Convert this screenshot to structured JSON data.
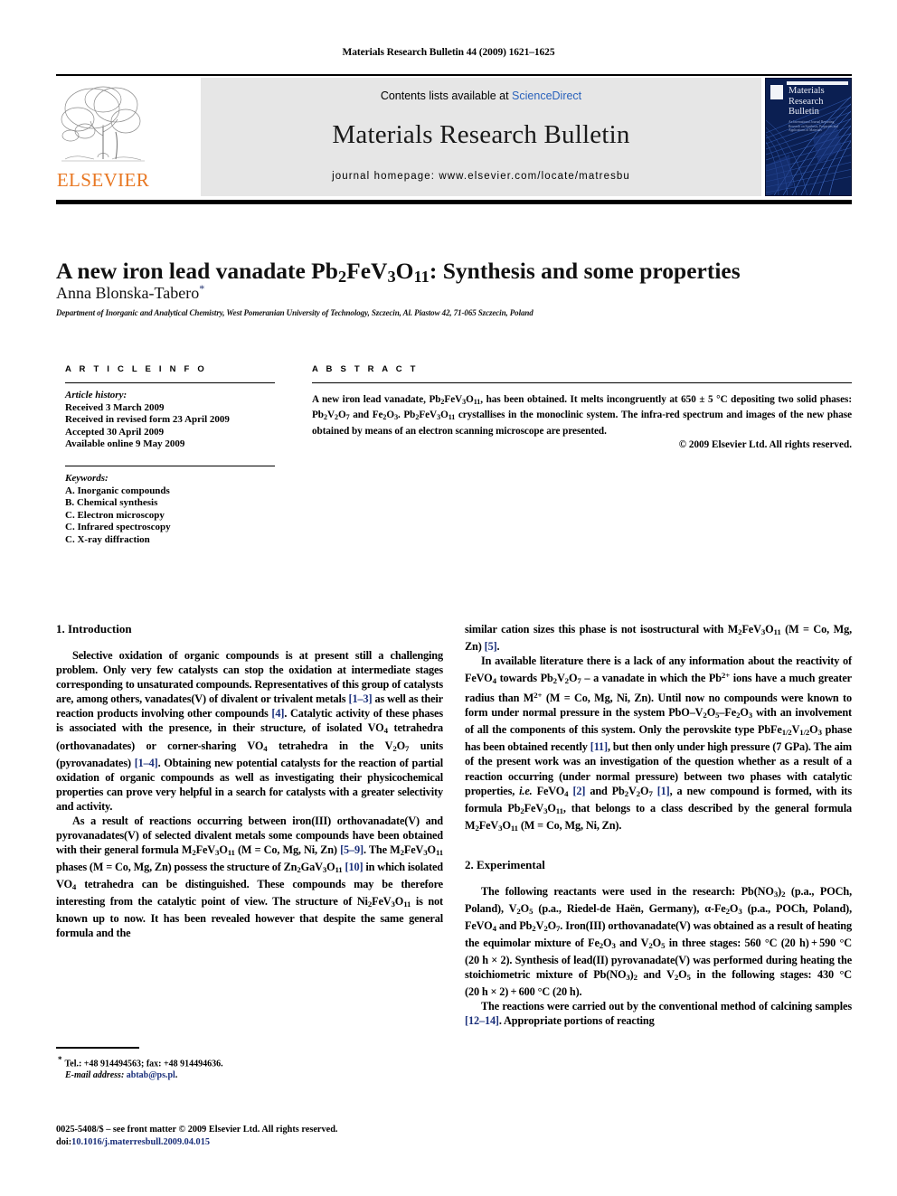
{
  "running_head": "Materials Research Bulletin 44 (2009) 1621–1625",
  "masthead": {
    "contents_prefix": "Contents lists available at ",
    "contents_link": "ScienceDirect",
    "journal_name": "Materials Research Bulletin",
    "homepage": "journal homepage: www.elsevier.com/locate/matresbu",
    "publisher_logo_text": "ELSEVIER",
    "cover_title_line1": "Materials",
    "cover_title_line2": "Research",
    "cover_title_line3": "Bulletin",
    "cover_subtitle": "An International Journal Reporting Research on Synthesis, Properties and Applications of Materials",
    "link_color": "#2a62bc",
    "elsevier_orange": "#E87722",
    "cover_navy": "#0b1f52"
  },
  "article": {
    "title_pre": "A new iron lead vanadate Pb",
    "title_sub1": "2",
    "title_mid1": "FeV",
    "title_sub2": "3",
    "title_mid2": "O",
    "title_sub3": "11",
    "title_post": ": Synthesis and some properties",
    "author": "Anna Blonska-Tabero",
    "author_marker": "*",
    "affiliation": "Department of Inorganic and Analytical Chemistry, West Pomeranian University of Technology, Szczecin, Al. Piastow 42, 71-065 Szczecin, Poland"
  },
  "article_info": {
    "heading": "A R T I C L E   I N F O",
    "history_label": "Article history:",
    "history": [
      "Received 3 March 2009",
      "Received in revised form 23 April 2009",
      "Accepted 30 April 2009",
      "Available online 9 May 2009"
    ],
    "keywords_label": "Keywords:",
    "keywords": [
      "A. Inorganic compounds",
      "B. Chemical synthesis",
      "C. Electron microscopy",
      "C. Infrared spectroscopy",
      "C. X-ray diffraction"
    ]
  },
  "abstract": {
    "heading": "A B S T R A C T",
    "copyright": "© 2009 Elsevier Ltd. All rights reserved."
  },
  "sections": {
    "introduction_heading": "1. Introduction",
    "experimental_heading": "2. Experimental"
  },
  "footnote": {
    "tel_fax": "Tel.: +48 914494563; fax: +48 914494636.",
    "email_label": "E-mail address:",
    "email": "abtab@ps.pl"
  },
  "publication_footer": {
    "issn_line": "0025-5408/$ – see front matter © 2009 Elsevier Ltd. All rights reserved.",
    "doi_label": "doi:",
    "doi": "10.1016/j.materresbull.2009.04.015"
  }
}
